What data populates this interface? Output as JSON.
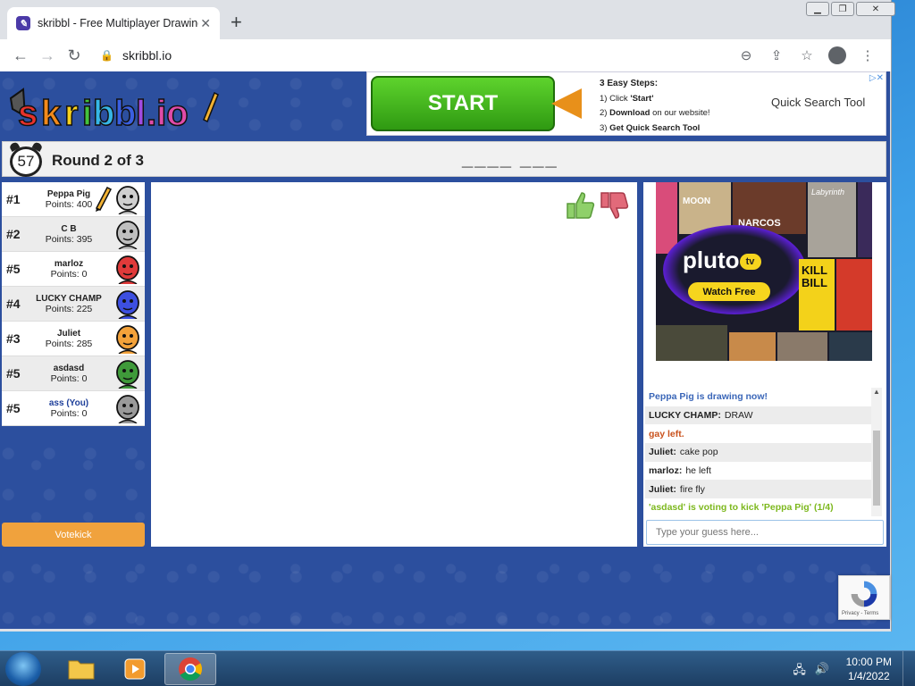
{
  "browser": {
    "tab_title": "skribbl - Free Multiplayer Drawing",
    "tab_favicon_letter": "✎",
    "new_tab": "+",
    "url": "skribbl.io"
  },
  "ad_top": {
    "start_label": "START",
    "steps_heading": "3 Easy Steps:",
    "step1_prefix": "1) Click ",
    "step1_bold": "'Start'",
    "step2_prefix": "2) ",
    "step2_bold": "Download",
    "step2_suffix": " on our website!",
    "step3_prefix": "3) ",
    "step3_bold": "Get Quick Search Tool",
    "right_text": "Quick Search Tool"
  },
  "game": {
    "timer": "57",
    "round_text": "Round 2 of 3",
    "word_hint": "____ ___"
  },
  "players": [
    {
      "rank": "#1",
      "name": "Peppa Pig",
      "points": "Points: 400",
      "drawing": true,
      "avatar_color": "#cfcfcf"
    },
    {
      "rank": "#2",
      "name": "C B",
      "points": "Points: 395",
      "drawing": false,
      "avatar_color": "#bfbfbf"
    },
    {
      "rank": "#5",
      "name": "marloz",
      "points": "Points: 0",
      "drawing": false,
      "avatar_color": "#e03a3a"
    },
    {
      "rank": "#4",
      "name": "LUCKY CHAMP",
      "points": "Points: 225",
      "drawing": false,
      "avatar_color": "#3d4fe0"
    },
    {
      "rank": "#3",
      "name": "Juliet",
      "points": "Points: 285",
      "drawing": false,
      "avatar_color": "#f3a23a"
    },
    {
      "rank": "#5",
      "name": "asdasd",
      "points": "Points: 0",
      "drawing": false,
      "avatar_color": "#3f9a3a"
    },
    {
      "rank": "#5",
      "name": "ass (You)",
      "points": "Points: 0",
      "drawing": false,
      "avatar_color": "#9a9a9a"
    }
  ],
  "votekick_label": "Votekick",
  "side_ad": {
    "poster_titles": [
      "MOON",
      "NARCOS",
      "Labyrinth",
      "KILL BILL"
    ],
    "brand": "pluto",
    "brand_badge": "tv",
    "cta": "Watch Free"
  },
  "chat": [
    {
      "who": "",
      "text": "Peppa Pig is drawing now!",
      "style": "blue"
    },
    {
      "who": "LUCKY CHAMP:",
      "text": "DRAW",
      "style": "normal"
    },
    {
      "who": "",
      "text": "gay left.",
      "style": "red"
    },
    {
      "who": "Juliet:",
      "text": "cake pop",
      "style": "normal"
    },
    {
      "who": "marloz:",
      "text": "he left",
      "style": "normal"
    },
    {
      "who": "Juliet:",
      "text": "fire fly",
      "style": "normal"
    },
    {
      "who": "",
      "text": "'asdasd' is voting to kick 'Peppa Pig' (1/4)",
      "style": "green"
    }
  ],
  "guess_placeholder": "Type your guess here...",
  "recaptcha_text": "Privacy - Terms",
  "taskbar": {
    "time": "10:00 PM",
    "date": "1/4/2022"
  },
  "colors": {
    "page_bg": "#2c4f9e",
    "votekick": "#f0a23d",
    "chat_blue": "#3a66b8",
    "chat_red": "#c9521d",
    "chat_green": "#7db81e"
  }
}
